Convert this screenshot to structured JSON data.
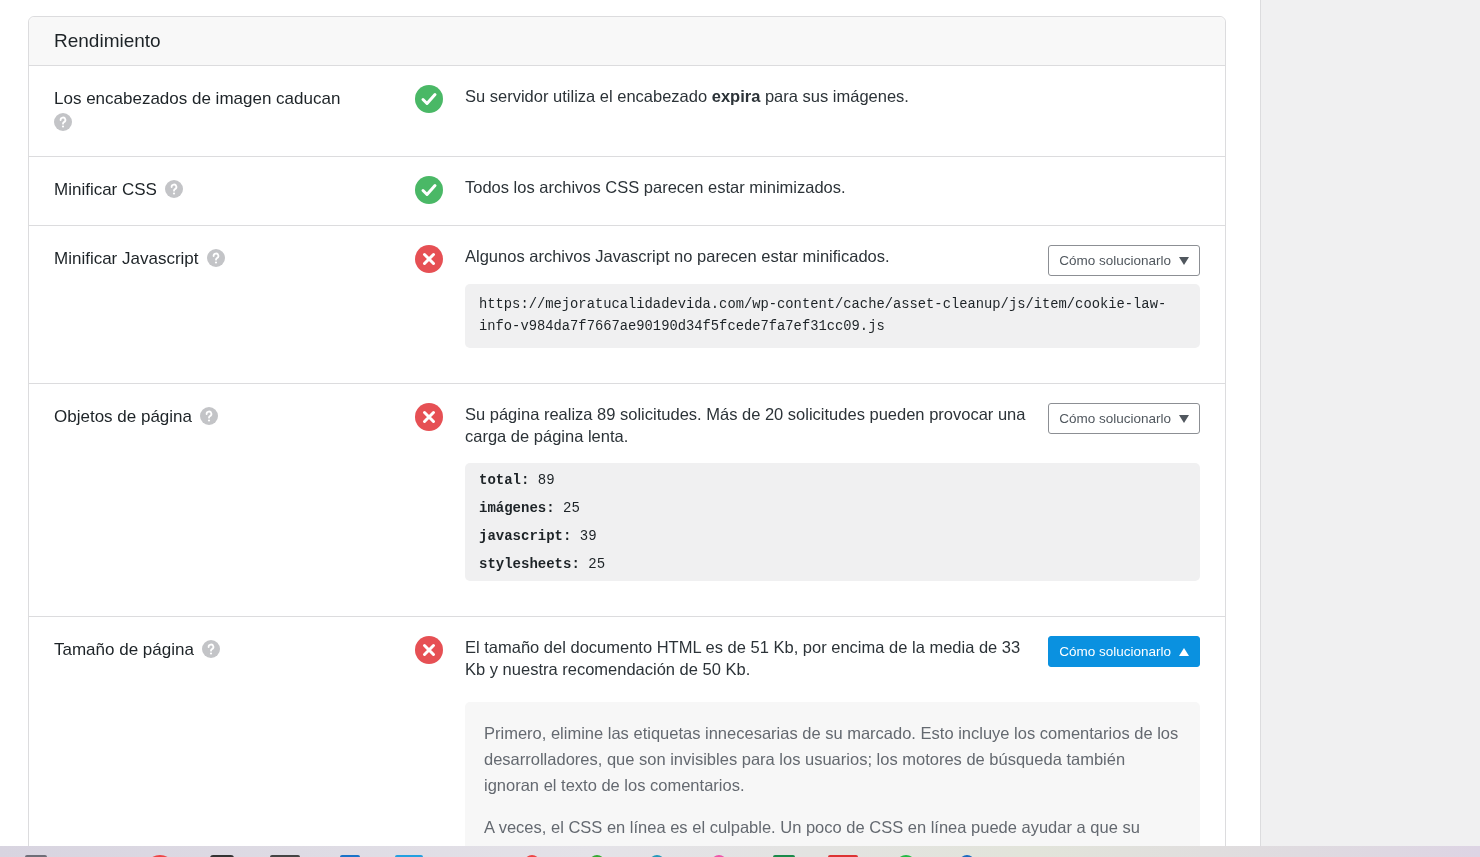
{
  "section": {
    "title": "Rendimiento"
  },
  "checks": [
    {
      "label": "Los encabezados de imagen caducan",
      "passed": true,
      "message": "Su servidor utiliza el encabezado **expira** para sus imágenes."
    },
    {
      "label": "Minificar CSS",
      "passed": true,
      "message": "Todos los archivos CSS parecen estar minimizados."
    },
    {
      "label": "Minificar Javascript",
      "passed": false,
      "message": "Algunos archivos Javascript no parecen estar minificados.",
      "fix_button": {
        "label": "Cómo solucionarlo",
        "expanded": false
      },
      "details": {
        "kind": "code",
        "lines": [
          "https://mejoratucalidadevida.com/wp-content/cache/asset-cleanup/js/item/cookie-law-info-v984da7f7667ae90190d34f5fcede7fa7ef31cc09.js"
        ]
      }
    },
    {
      "label": "Objetos de página",
      "passed": false,
      "message": "Su página realiza 89 solicitudes. Más de 20 solicitudes pueden provocar una carga de página lenta.",
      "fix_button": {
        "label": "Cómo solucionarlo",
        "expanded": false
      },
      "details": {
        "kind": "stats",
        "items": [
          {
            "key": "total:",
            "value": "89"
          },
          {
            "key": "imágenes:",
            "value": "25"
          },
          {
            "key": "javascript:",
            "value": "39"
          },
          {
            "key": "stylesheets:",
            "value": "25"
          }
        ]
      }
    },
    {
      "label": "Tamaño de página",
      "passed": false,
      "message": "El tamaño del documento HTML es de 51 Kb, por encima de la media de 33 Kb y nuestra recomendación de 50 Kb.",
      "fix_button": {
        "label": "Cómo solucionarlo",
        "expanded": true
      },
      "details": {
        "kind": "advice",
        "paragraphs": [
          "Primero, elimine las etiquetas innecesarias de su marcado. Esto incluye los comentarios de los desarrolladores, que son invisibles para los usuarios; los motores de búsqueda también ignoran el texto de los comentarios.",
          "A veces, el CSS en línea es el culpable. Un poco de CSS en línea puede ayudar a que su"
        ]
      }
    }
  ]
}
